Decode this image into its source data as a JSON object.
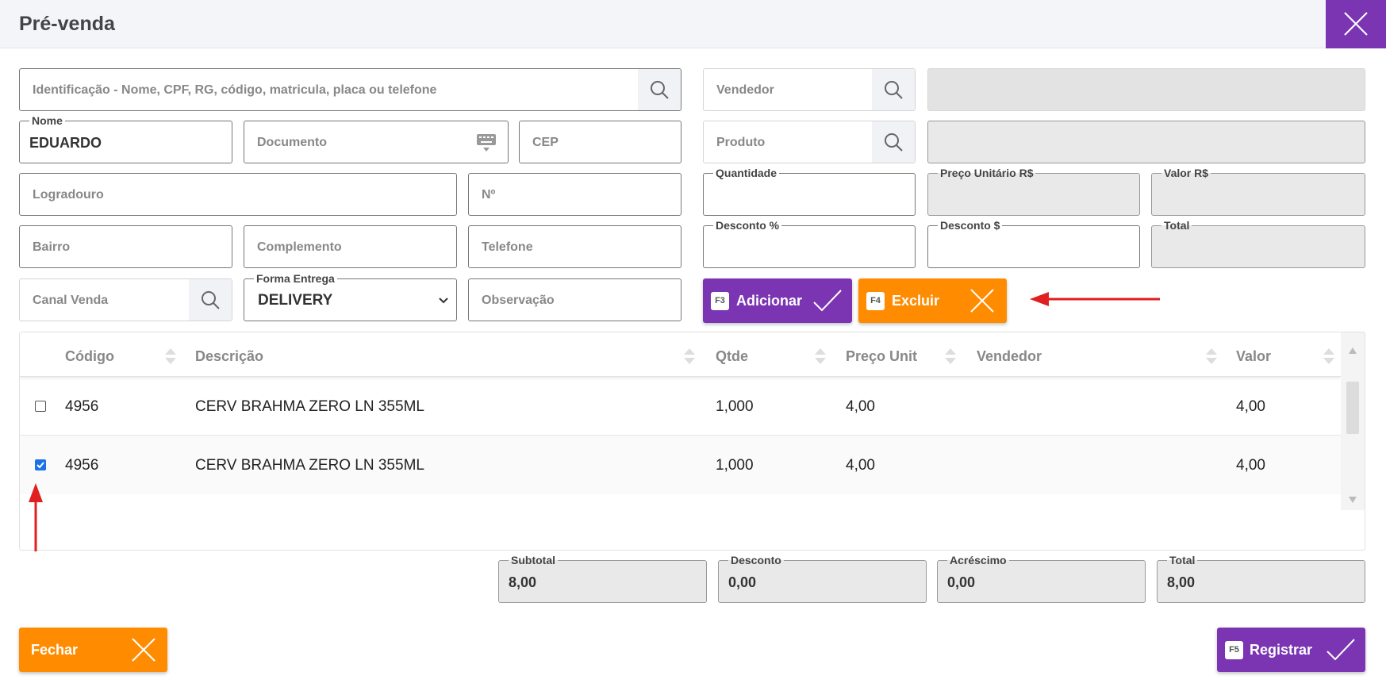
{
  "header": {
    "title": "Pré-venda"
  },
  "customer": {
    "id_placeholder": "Identificação - Nome, CPF, RG, código, matricula, placa ou telefone",
    "nome_label": "Nome",
    "nome_value": "EDUARDO",
    "documento_placeholder": "Documento",
    "cep_placeholder": "CEP",
    "logradouro_placeholder": "Logradouro",
    "numero_placeholder": "Nº",
    "bairro_placeholder": "Bairro",
    "complemento_placeholder": "Complemento",
    "telefone_placeholder": "Telefone",
    "canal_venda_placeholder": "Canal Venda",
    "forma_entrega_label": "Forma Entrega",
    "forma_entrega_value": "DELIVERY",
    "observacao_placeholder": "Observação"
  },
  "product": {
    "vendedor_placeholder": "Vendedor",
    "produto_placeholder": "Produto",
    "quantidade_label": "Quantidade",
    "preco_unitario_label": "Preço Unitário R$",
    "valor_label": "Valor R$",
    "desconto_pct_label": "Desconto %",
    "desconto_val_label": "Desconto $",
    "total_label": "Total"
  },
  "actions": {
    "adicionar_key": "F3",
    "adicionar_label": "Adicionar",
    "excluir_key": "F4",
    "excluir_label": "Excluir",
    "fechar_label": "Fechar",
    "registrar_key": "F5",
    "registrar_label": "Registrar"
  },
  "table": {
    "columns": [
      "Código",
      "Descrição",
      "Qtde",
      "Preço Unit",
      "Vendedor",
      "Valor"
    ],
    "rows": [
      {
        "checked": false,
        "codigo": "4956",
        "descricao": "CERV BRAHMA ZERO LN 355ML",
        "qtde": "1,000",
        "preco": "4,00",
        "vendedor": "",
        "valor": "4,00"
      },
      {
        "checked": true,
        "codigo": "4956",
        "descricao": "CERV BRAHMA ZERO LN 355ML",
        "qtde": "1,000",
        "preco": "4,00",
        "vendedor": "",
        "valor": "4,00"
      }
    ]
  },
  "totals": {
    "subtotal_label": "Subtotal",
    "subtotal_value": "8,00",
    "desconto_label": "Desconto",
    "desconto_value": "0,00",
    "acrescimo_label": "Acréscimo",
    "acrescimo_value": "0,00",
    "total_label": "Total",
    "total_value": "8,00"
  },
  "colors": {
    "purple": "#7b35b3",
    "orange": "#ff8c00",
    "annotation_red": "#e02020"
  }
}
